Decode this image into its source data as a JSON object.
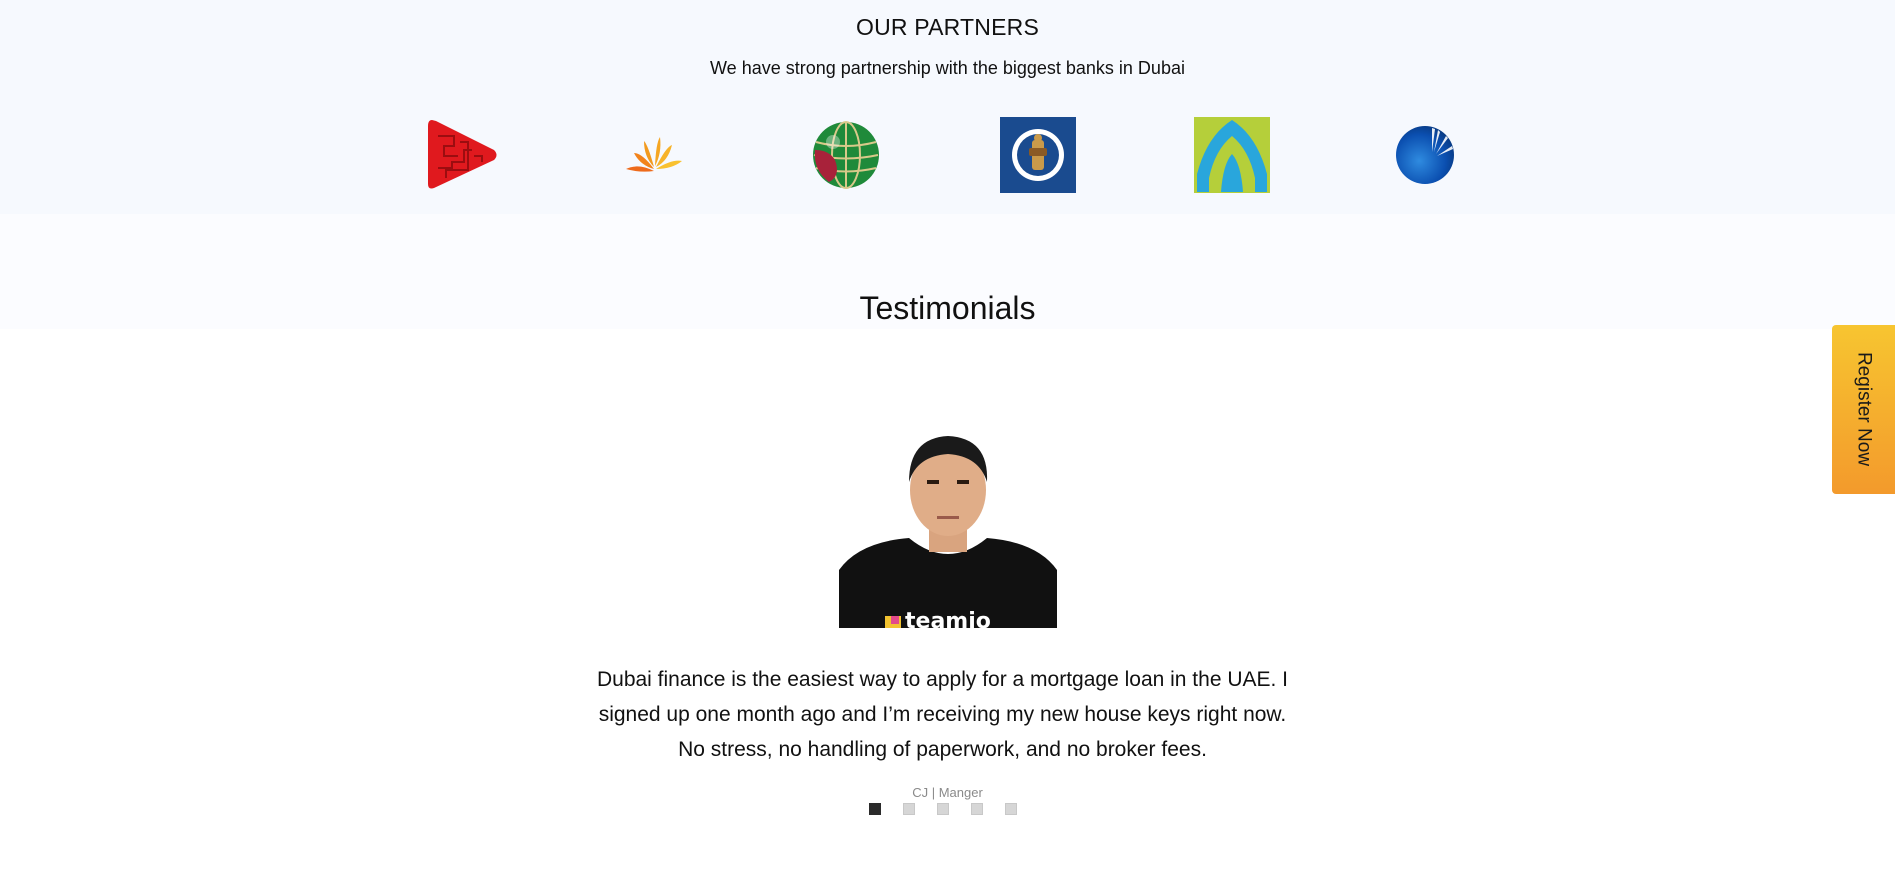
{
  "partners": {
    "title": "OUR PARTNERS",
    "subtitle": "We have strong partnership with the biggest banks in Dubai",
    "logos": [
      {
        "icon": "red-triangle-bank-logo"
      },
      {
        "icon": "orange-fan-bank-logo"
      },
      {
        "icon": "green-globe-bank-logo"
      },
      {
        "icon": "blue-emblem-bank-logo"
      },
      {
        "icon": "green-blue-arch-bank-logo"
      },
      {
        "icon": "blue-sphere-bank-logo"
      }
    ]
  },
  "testimonials": {
    "title": "Testimonials",
    "quote": "Dubai finance is the easiest way to apply for a mortgage loan in the UAE. I signed up one month ago and I’m receiving my new house keys right now. No stress, no handling of paperwork, and no broker fees.",
    "author": "CJ | Manger",
    "shirt_text": "teamio",
    "slides": 5,
    "active_slide": 1
  },
  "register": {
    "label": "Register Now"
  },
  "colors": {
    "partners_bg": "#f6f9fe",
    "register_top": "#f7c530",
    "register_bottom": "#f39a2c"
  }
}
